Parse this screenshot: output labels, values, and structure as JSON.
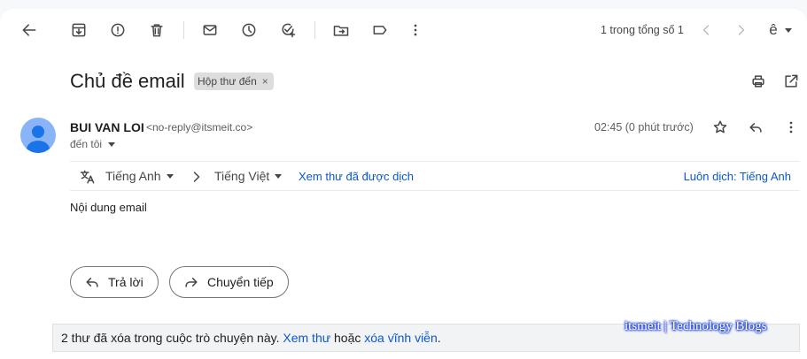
{
  "toolbar": {
    "counter": "1 trong tổng số 1"
  },
  "email": {
    "subject": "Chủ đề email",
    "label": "Hộp thư đến",
    "label_remove": "×",
    "sender_name": "BUI VAN LOI",
    "sender_email": "<no-reply@itsmeit.co>",
    "recipient": "đến tôi",
    "timestamp": "02:45 (0 phút trước)",
    "body": "Nội dung email"
  },
  "translate": {
    "source_lang": "Tiếng Anh",
    "target_lang": "Tiếng Việt",
    "view_translated": "Xem thư đã được dịch",
    "always_translate": "Luôn dịch: Tiếng Anh"
  },
  "actions": {
    "reply": "Trả lời",
    "forward": "Chuyển tiếp"
  },
  "notice": {
    "text_before": "2 thư đã xóa trong cuộc trò chuyện này.",
    "view_link": "Xem thư",
    "text_middle": "hoặc",
    "delete_link": "xóa vĩnh viễn",
    "text_end": "."
  },
  "watermark": "itsmeit | Technology Blogs",
  "colors": {
    "link": "#0b57d0",
    "avatar": "#8ab4f8",
    "avatar_figure": "#1a73e8"
  }
}
